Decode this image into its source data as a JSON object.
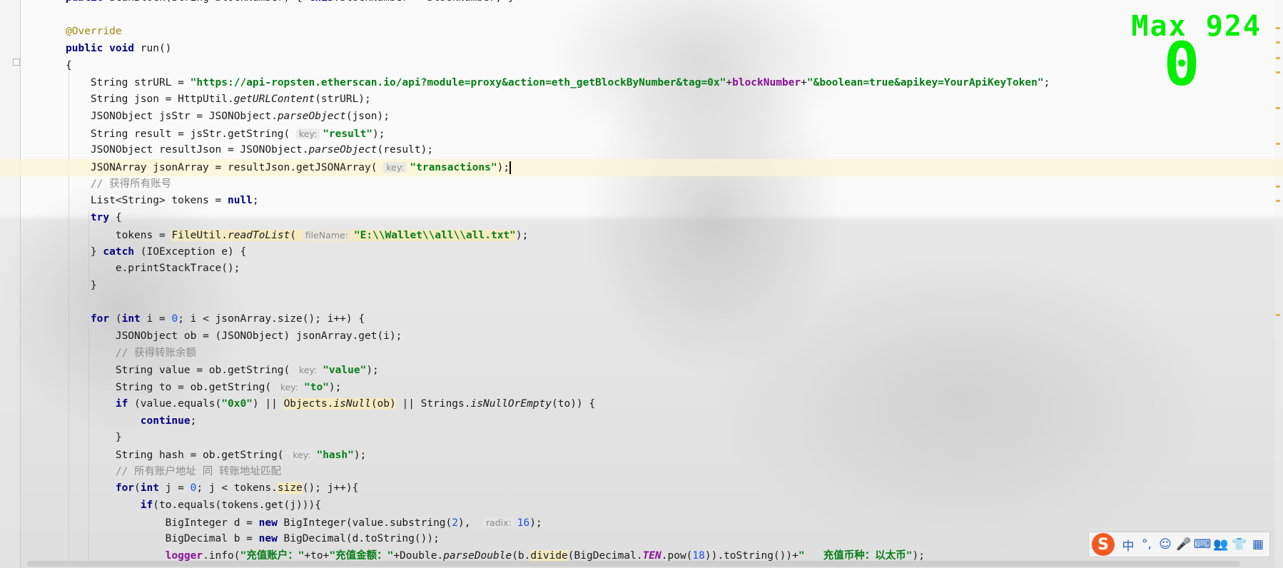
{
  "editor": {
    "lines": [
      {
        "id": "l0",
        "html": "<span class=\"kw\">public</span> ScanBlock(String blockNumber) { <span class=\"kw\">this</span>.blockNumber = blockNumber; }"
      },
      {
        "id": "l1",
        "html": ""
      },
      {
        "id": "l2",
        "html": "<span class=\"ann\">@Override</span>"
      },
      {
        "id": "l3",
        "html": "<span class=\"kw\">public void</span> run()"
      },
      {
        "id": "l4",
        "html": "{"
      },
      {
        "id": "l5",
        "html": "    String strURL = <span class=\"str\">\"https://api-ropsten.etherscan.io/api?module=proxy&amp;action=eth_getBlockByNumber&amp;tag=0x\"</span>+<span class=\"fld\">blockNumber</span>+<span class=\"str\">\"&amp;boolean=true&amp;apikey=YourApiKeyToken\"</span>;"
      },
      {
        "id": "l6",
        "html": "    String json = HttpUtil.<span class=\"ital\">getURLContent</span>(strURL);"
      },
      {
        "id": "l7",
        "html": "    JSONObject jsStr = JSONObject.<span class=\"ital\">parseObject</span>(json);"
      },
      {
        "id": "l8",
        "html": "    String result = jsStr.getString( <span class=\"hint\">key:</span><span class=\"str\">\"result\"</span>);"
      },
      {
        "id": "l9",
        "html": "    JSONObject resultJson = JSONObject.<span class=\"ital\">parseObject</span>(result);"
      },
      {
        "id": "l10",
        "html": "    JSONArray jsonArray = resultJson.getJSONArray( <span class=\"hint\">key:</span><span class=\"str\">\"transactions\"</span>);<span class=\"caret\"></span>"
      },
      {
        "id": "l11",
        "html": "    <span class=\"cmt\">// 获得所有账号</span>"
      },
      {
        "id": "l12",
        "html": "    List&lt;String&gt; tokens = <span class=\"kw\">null</span>;"
      },
      {
        "id": "l13",
        "html": "    <span class=\"kw\">try</span> {"
      },
      {
        "id": "l14",
        "html": "        tokens = <span class=\"warnbg\">FileUtil.<span class=\"ital\">readToList</span>( <span class=\"hint\">fileName:</span><span class=\"str\">\"E:\\\\Wallet\\\\all\\\\all.txt\"</span></span>);"
      },
      {
        "id": "l15",
        "html": "    } <span class=\"kw\">catch</span> (IOException e) {"
      },
      {
        "id": "l16",
        "html": "        e.printStackTrace();"
      },
      {
        "id": "l17",
        "html": "    }"
      },
      {
        "id": "l18",
        "html": ""
      },
      {
        "id": "l19",
        "html": "    <span class=\"kw\">for</span> (<span class=\"kw\">int</span> i = <span class=\"num\">0</span>; i &lt; jsonArray.size(); i++) {"
      },
      {
        "id": "l20",
        "html": "        JSONObject ob = (JSONObject) jsonArray.get(i);"
      },
      {
        "id": "l21",
        "html": "        <span class=\"cmt\">// 获得转账余额</span>"
      },
      {
        "id": "l22",
        "html": "        String value = ob.getString( <span class=\"hint\">key:</span><span class=\"str\">\"value\"</span>);"
      },
      {
        "id": "l23",
        "html": "        String to = ob.getString( <span class=\"hint\">key:</span><span class=\"str\">\"to\"</span>);"
      },
      {
        "id": "l24",
        "html": "        <span class=\"kw\">if</span> (value.equals(<span class=\"str\">\"0x0\"</span>) || <span class=\"warnbg\">Objects.<span class=\"ital\">isNull</span>(ob)</span> || Strings.<span class=\"ital\">isNullOrEmpty</span>(to)) {"
      },
      {
        "id": "l25",
        "html": "            <span class=\"kw\">continue</span>;"
      },
      {
        "id": "l26",
        "html": "        }"
      },
      {
        "id": "l27",
        "html": "        String hash = ob.getString( <span class=\"hint\">key:</span><span class=\"str\">\"hash\"</span>);"
      },
      {
        "id": "l28",
        "html": "        <span class=\"cmt\">// 所有账户地址 同 转账地址匹配</span>"
      },
      {
        "id": "l29",
        "html": "        <span class=\"kw\">for</span>(<span class=\"kw\">int</span> j = <span class=\"num\">0</span>; j &lt; tokens.<span class=\"warnbg\">size</span>(); j++){"
      },
      {
        "id": "l30",
        "html": "            <span class=\"kw\">if</span>(to.equals(tokens.get(j))){"
      },
      {
        "id": "l31",
        "html": "                BigInteger d = <span class=\"kw\">new</span> BigInteger(value.substring(<span class=\"num\">2</span>),  <span class=\"hint\">radix:</span><span class=\"num\">16</span>);"
      },
      {
        "id": "l32",
        "html": "                BigDecimal b = <span class=\"kw\">new</span> BigDecimal(d.toString());"
      },
      {
        "id": "l33",
        "html": "                <span class=\"fld\">logger</span>.info(<span class=\"str\">\"充值账户：\"</span>+to+<span class=\"str\">\"充值金额：\"</span>+Double.<span class=\"ital\">parseDouble</span>(b.<span class=\"warnbg\">divide</span>(BigDecimal.<span class=\"fld ital\">TEN</span>.pow(<span class=\"num\">18</span>)).toString())+<span class=\"str\">\"   充值币种：以太币\"</span>);"
      }
    ]
  },
  "overlay": {
    "max_label": "Max 924",
    "score": "0"
  },
  "ime": {
    "logo": "S",
    "buttons": [
      "中",
      "°,",
      "☺",
      "🎤",
      "⌨",
      "👥",
      "👕",
      "▦"
    ]
  }
}
